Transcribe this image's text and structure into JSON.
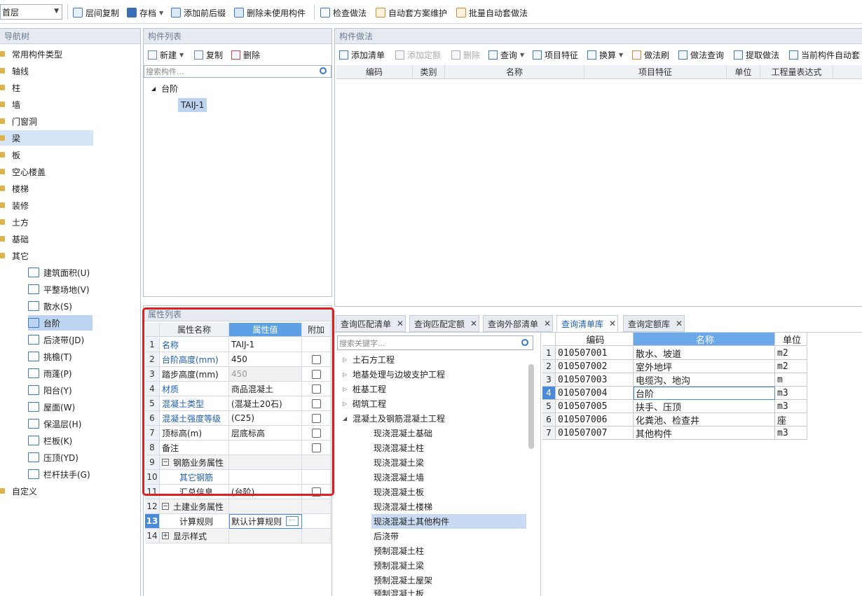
{
  "toolbar": {
    "floor": "首层",
    "copy_floor": "层间复制",
    "save": "存档",
    "add_prefix": "添加前后缀",
    "delete_unused": "删除未使用构件",
    "check_method": "检查做法",
    "auto_scheme": "自动套方案维护",
    "batch_auto": "批量自动套做法"
  },
  "nav": {
    "title": "导航树",
    "items": [
      "常用构件类型",
      "轴线",
      "柱",
      "墙",
      "门窗洞",
      "梁",
      "板",
      "空心楼盖",
      "楼梯",
      "装修",
      "土方",
      "基础",
      "其它"
    ],
    "sub_items": [
      "建筑面积(U)",
      "平整场地(V)",
      "散水(S)",
      "台阶",
      "后浇带(JD)",
      "挑檐(T)",
      "雨蓬(P)",
      "阳台(Y)",
      "屋面(W)",
      "保温层(H)",
      "栏板(K)",
      "压顶(YD)",
      "栏杆扶手(G)"
    ],
    "last": "自定义"
  },
  "comp_list": {
    "title": "构件列表",
    "new": "新建",
    "copy": "复制",
    "delete": "删除",
    "search_placeholder": "搜索构件...",
    "group": "台阶",
    "item": "TAIJ-1"
  },
  "method": {
    "title": "构件做法",
    "add_list": "添加清单",
    "add_quota": "添加定额",
    "delete": "删除",
    "query": "查询",
    "feature": "项目特征",
    "convert": "换算",
    "brush": "做法刷",
    "method_query": "做法查询",
    "extract": "提取做法",
    "current_auto": "当前构件自动套",
    "cols": [
      "编码",
      "类别",
      "名称",
      "项目特征",
      "单位",
      "工程量表达式"
    ]
  },
  "props": {
    "title": "属性列表",
    "cols": [
      "属性名称",
      "属性值",
      "附加"
    ],
    "rows": [
      {
        "n": "1",
        "name": "名称",
        "val": "TAIJ-1"
      },
      {
        "n": "2",
        "name": "台阶高度(mm)",
        "val": "450"
      },
      {
        "n": "3",
        "name": "踏步高度(mm)",
        "val": "450"
      },
      {
        "n": "4",
        "name": "材质",
        "val": "商品混凝土"
      },
      {
        "n": "5",
        "name": "混凝土类型",
        "val": "(混凝土20石)"
      },
      {
        "n": "6",
        "name": "混凝土强度等级",
        "val": "(C25)"
      },
      {
        "n": "7",
        "name": "顶标高(m)",
        "val": "层底标高"
      },
      {
        "n": "8",
        "name": "备注",
        "val": ""
      },
      {
        "n": "9",
        "name": "钢筋业务属性",
        "val": ""
      },
      {
        "n": "10",
        "name": "其它钢筋",
        "val": ""
      },
      {
        "n": "11",
        "name": "汇总信息",
        "val": "(台阶)"
      },
      {
        "n": "12",
        "name": "土建业务属性",
        "val": ""
      },
      {
        "n": "13",
        "name": "计算规则",
        "val": "默认计算规则"
      },
      {
        "n": "14",
        "name": "显示样式",
        "val": ""
      }
    ]
  },
  "tabs": [
    "查询匹配清单",
    "查询匹配定额",
    "查询外部清单",
    "查询清单库",
    "查询定额库"
  ],
  "library": {
    "search_placeholder": "搜索关键字...",
    "items": [
      "土石方工程",
      "地基处理与边坡支护工程",
      "桩基工程",
      "砌筑工程",
      "混凝土及钢筋混凝土工程"
    ],
    "sub_items": [
      "现浇混凝土基础",
      "现浇混凝土柱",
      "现浇混凝土梁",
      "现浇混凝土墙",
      "现浇混凝土板",
      "现浇混凝土楼梯",
      "现浇混凝土其他构件",
      "后浇带",
      "预制混凝土柱",
      "预制混凝土梁",
      "预制混凝土屋架",
      "预制混凝土板"
    ]
  },
  "results": {
    "cols": [
      "编码",
      "名称",
      "单位"
    ],
    "rows": [
      {
        "n": "1",
        "code": "010507001",
        "name": "散水、坡道",
        "unit": "m2"
      },
      {
        "n": "2",
        "code": "010507002",
        "name": "室外地坪",
        "unit": "m2"
      },
      {
        "n": "3",
        "code": "010507003",
        "name": "电缆沟、地沟",
        "unit": "m"
      },
      {
        "n": "4",
        "code": "010507004",
        "name": "台阶",
        "unit": "m3"
      },
      {
        "n": "5",
        "code": "010507005",
        "name": "扶手、压顶",
        "unit": "m3"
      },
      {
        "n": "6",
        "code": "010507006",
        "name": "化粪池、检查井",
        "unit": "座"
      },
      {
        "n": "7",
        "code": "010507007",
        "name": "其他构件",
        "unit": "m3"
      }
    ]
  },
  "colors": {
    "accent": "#1e5fb4",
    "highlight_box": "#e02020",
    "selection": "#c9dbf2"
  }
}
